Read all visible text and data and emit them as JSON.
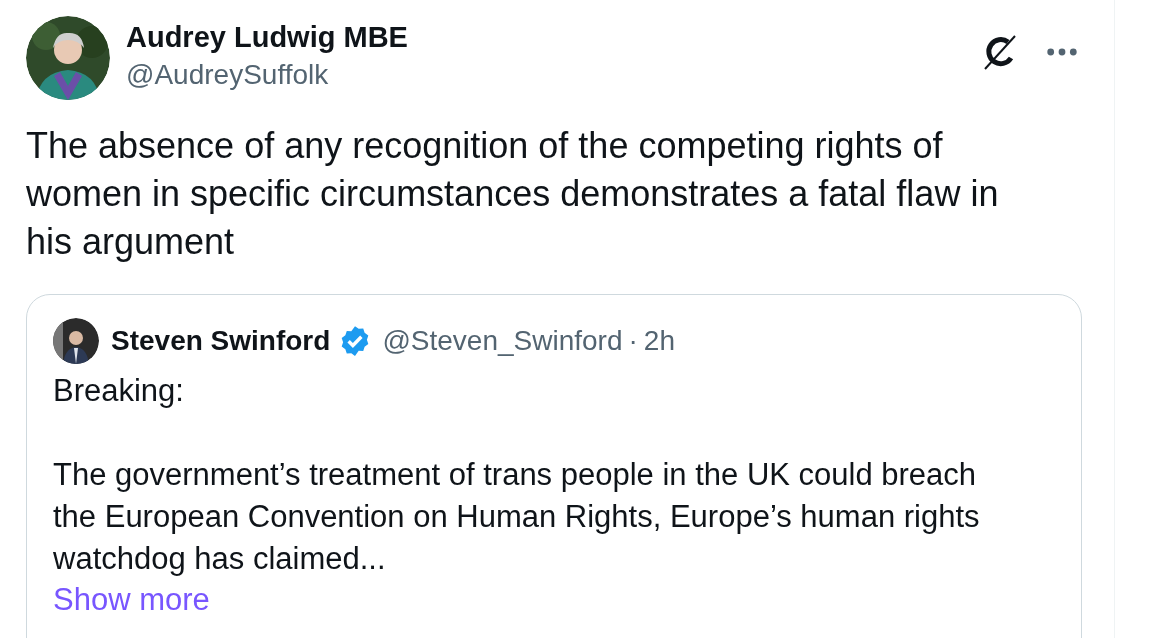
{
  "author": {
    "name": "Audrey Ludwig MBE",
    "handle": "@AudreySuffolk"
  },
  "text": "The absence of any recognition of the competing rights of women in specific circumstances demonstrates a fatal flaw in his argument",
  "quote": {
    "name": "Steven Swinford",
    "verified": true,
    "handle": "@Steven_Swinford",
    "separator": "·",
    "time": "2h",
    "paragraphs": [
      "Breaking:",
      "The government’s treatment of trans people in the UK could breach the European Convention on Human Rights, Europe’s human rights watchdog has claimed..."
    ],
    "show_more": "Show more"
  }
}
